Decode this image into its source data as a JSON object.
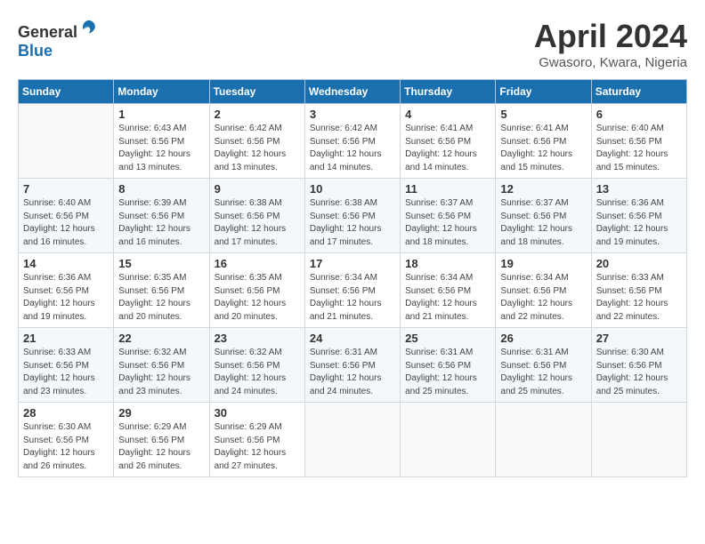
{
  "header": {
    "logo": {
      "general": "General",
      "blue": "Blue"
    },
    "title": "April 2024",
    "location": "Gwasoro, Kwara, Nigeria"
  },
  "weekdays": [
    "Sunday",
    "Monday",
    "Tuesday",
    "Wednesday",
    "Thursday",
    "Friday",
    "Saturday"
  ],
  "weeks": [
    [
      {
        "day": null
      },
      {
        "day": 1,
        "sunrise": "6:43 AM",
        "sunset": "6:56 PM",
        "daylight": "12 hours and 13 minutes."
      },
      {
        "day": 2,
        "sunrise": "6:42 AM",
        "sunset": "6:56 PM",
        "daylight": "12 hours and 13 minutes."
      },
      {
        "day": 3,
        "sunrise": "6:42 AM",
        "sunset": "6:56 PM",
        "daylight": "12 hours and 14 minutes."
      },
      {
        "day": 4,
        "sunrise": "6:41 AM",
        "sunset": "6:56 PM",
        "daylight": "12 hours and 14 minutes."
      },
      {
        "day": 5,
        "sunrise": "6:41 AM",
        "sunset": "6:56 PM",
        "daylight": "12 hours and 15 minutes."
      },
      {
        "day": 6,
        "sunrise": "6:40 AM",
        "sunset": "6:56 PM",
        "daylight": "12 hours and 15 minutes."
      }
    ],
    [
      {
        "day": 7,
        "sunrise": "6:40 AM",
        "sunset": "6:56 PM",
        "daylight": "12 hours and 16 minutes."
      },
      {
        "day": 8,
        "sunrise": "6:39 AM",
        "sunset": "6:56 PM",
        "daylight": "12 hours and 16 minutes."
      },
      {
        "day": 9,
        "sunrise": "6:38 AM",
        "sunset": "6:56 PM",
        "daylight": "12 hours and 17 minutes."
      },
      {
        "day": 10,
        "sunrise": "6:38 AM",
        "sunset": "6:56 PM",
        "daylight": "12 hours and 17 minutes."
      },
      {
        "day": 11,
        "sunrise": "6:37 AM",
        "sunset": "6:56 PM",
        "daylight": "12 hours and 18 minutes."
      },
      {
        "day": 12,
        "sunrise": "6:37 AM",
        "sunset": "6:56 PM",
        "daylight": "12 hours and 18 minutes."
      },
      {
        "day": 13,
        "sunrise": "6:36 AM",
        "sunset": "6:56 PM",
        "daylight": "12 hours and 19 minutes."
      }
    ],
    [
      {
        "day": 14,
        "sunrise": "6:36 AM",
        "sunset": "6:56 PM",
        "daylight": "12 hours and 19 minutes."
      },
      {
        "day": 15,
        "sunrise": "6:35 AM",
        "sunset": "6:56 PM",
        "daylight": "12 hours and 20 minutes."
      },
      {
        "day": 16,
        "sunrise": "6:35 AM",
        "sunset": "6:56 PM",
        "daylight": "12 hours and 20 minutes."
      },
      {
        "day": 17,
        "sunrise": "6:34 AM",
        "sunset": "6:56 PM",
        "daylight": "12 hours and 21 minutes."
      },
      {
        "day": 18,
        "sunrise": "6:34 AM",
        "sunset": "6:56 PM",
        "daylight": "12 hours and 21 minutes."
      },
      {
        "day": 19,
        "sunrise": "6:34 AM",
        "sunset": "6:56 PM",
        "daylight": "12 hours and 22 minutes."
      },
      {
        "day": 20,
        "sunrise": "6:33 AM",
        "sunset": "6:56 PM",
        "daylight": "12 hours and 22 minutes."
      }
    ],
    [
      {
        "day": 21,
        "sunrise": "6:33 AM",
        "sunset": "6:56 PM",
        "daylight": "12 hours and 23 minutes."
      },
      {
        "day": 22,
        "sunrise": "6:32 AM",
        "sunset": "6:56 PM",
        "daylight": "12 hours and 23 minutes."
      },
      {
        "day": 23,
        "sunrise": "6:32 AM",
        "sunset": "6:56 PM",
        "daylight": "12 hours and 24 minutes."
      },
      {
        "day": 24,
        "sunrise": "6:31 AM",
        "sunset": "6:56 PM",
        "daylight": "12 hours and 24 minutes."
      },
      {
        "day": 25,
        "sunrise": "6:31 AM",
        "sunset": "6:56 PM",
        "daylight": "12 hours and 25 minutes."
      },
      {
        "day": 26,
        "sunrise": "6:31 AM",
        "sunset": "6:56 PM",
        "daylight": "12 hours and 25 minutes."
      },
      {
        "day": 27,
        "sunrise": "6:30 AM",
        "sunset": "6:56 PM",
        "daylight": "12 hours and 25 minutes."
      }
    ],
    [
      {
        "day": 28,
        "sunrise": "6:30 AM",
        "sunset": "6:56 PM",
        "daylight": "12 hours and 26 minutes."
      },
      {
        "day": 29,
        "sunrise": "6:29 AM",
        "sunset": "6:56 PM",
        "daylight": "12 hours and 26 minutes."
      },
      {
        "day": 30,
        "sunrise": "6:29 AM",
        "sunset": "6:56 PM",
        "daylight": "12 hours and 27 minutes."
      },
      {
        "day": null
      },
      {
        "day": null
      },
      {
        "day": null
      },
      {
        "day": null
      }
    ]
  ],
  "labels": {
    "sunrise_prefix": "Sunrise: ",
    "sunset_prefix": "Sunset: ",
    "daylight_prefix": "Daylight: "
  }
}
